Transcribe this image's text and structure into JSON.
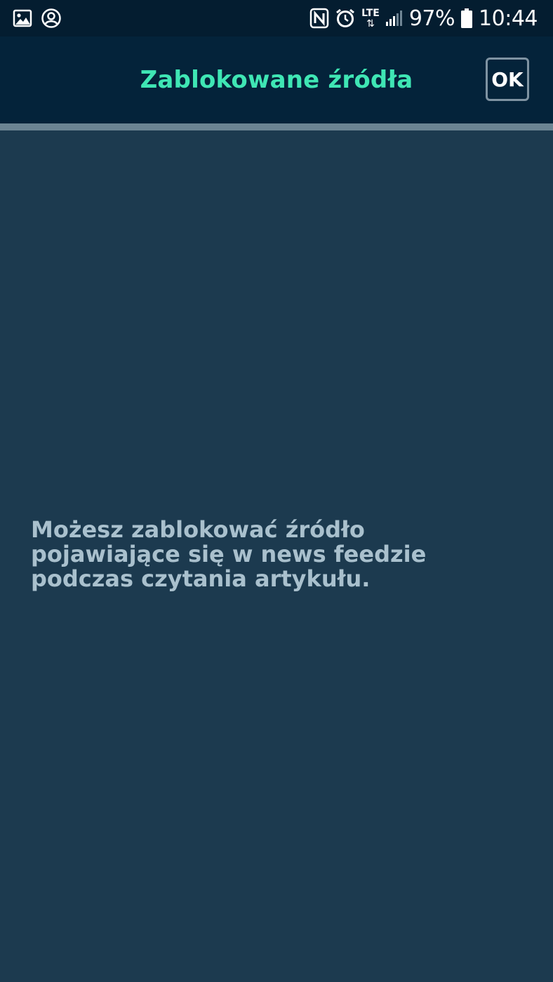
{
  "status_bar": {
    "left_icons": [
      "image-icon",
      "account-circle-icon"
    ],
    "right_icons": [
      "nfc-icon",
      "alarm-icon",
      "lte-icon",
      "signal-icon",
      "battery-icon"
    ],
    "network_label": "LTE",
    "battery_percent": "97%",
    "time": "10:44"
  },
  "app_bar": {
    "title": "Zablokowane źródła",
    "ok_label": "OK"
  },
  "content": {
    "empty_message": "Możesz zablokować źródło pojawiające się w news feedzie podczas czytania artykułu."
  },
  "colors": {
    "status_bar_bg": "#041d30",
    "app_bar_bg": "#04233a",
    "title_color": "#3fe6b4",
    "content_bg": "#1c3a4f",
    "message_color": "#a9c0cd",
    "divider": "#6b8493"
  }
}
